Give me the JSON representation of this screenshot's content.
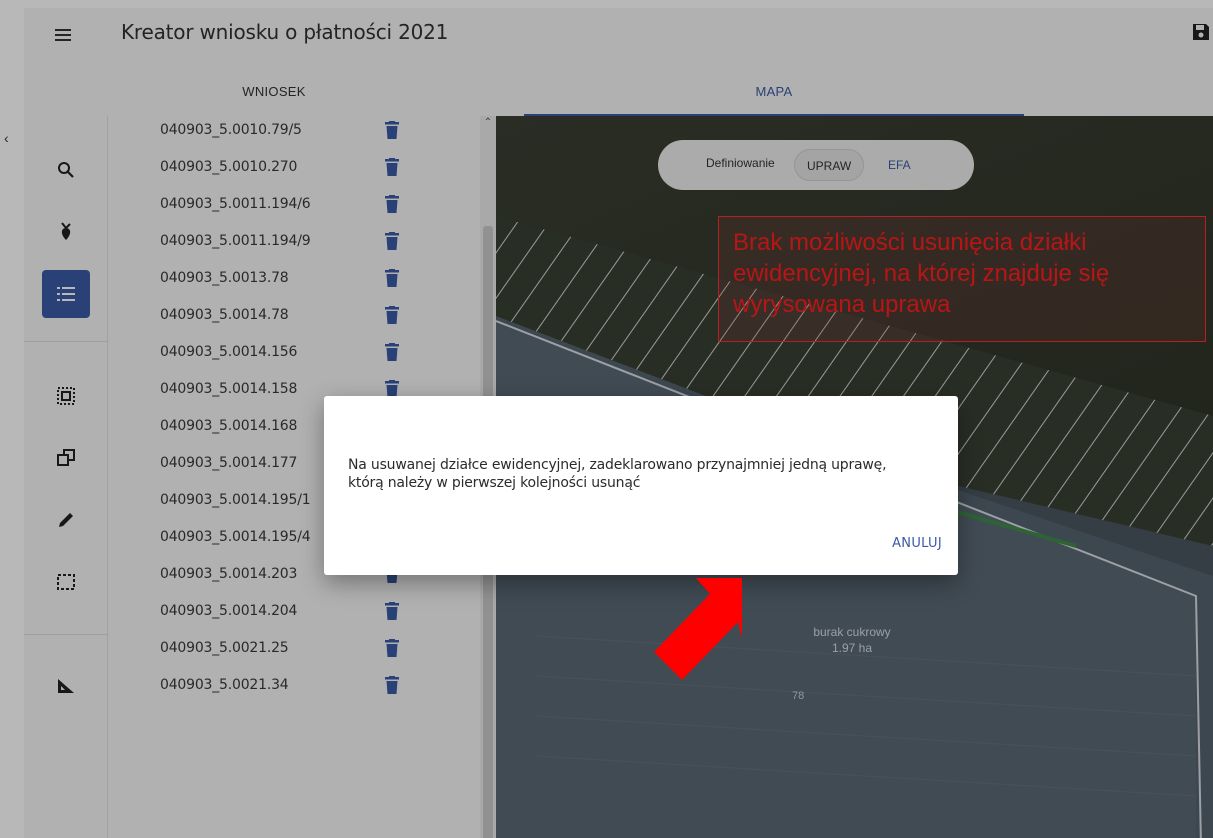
{
  "header": {
    "title": "Kreator wniosku o płatności 2021",
    "menu_icon": "menu-icon",
    "save_icon": "save-icon"
  },
  "tabs": [
    {
      "label": "WNIOSEK",
      "active": false
    },
    {
      "label": "MAPA",
      "active": true
    }
  ],
  "rail": {
    "items": [
      {
        "icon": "search-icon",
        "active": false
      },
      {
        "icon": "crop-plant-icon",
        "active": false
      },
      {
        "icon": "list-icon",
        "active": true
      },
      {
        "icon": "select-parcel-icon",
        "active": false
      },
      {
        "icon": "copy-shape-icon",
        "active": false
      },
      {
        "icon": "pencil-icon",
        "active": false
      },
      {
        "icon": "dashed-rect-icon",
        "active": false
      },
      {
        "icon": "measure-icon",
        "active": false
      }
    ]
  },
  "parcels": [
    "040903_5.0010.79/5",
    "040903_5.0010.270",
    "040903_5.0011.194/6",
    "040903_5.0011.194/9",
    "040903_5.0013.78",
    "040903_5.0014.78",
    "040903_5.0014.156",
    "040903_5.0014.158",
    "040903_5.0014.168",
    "040903_5.0014.177",
    "040903_5.0014.195/1",
    "040903_5.0014.195/4",
    "040903_5.0014.203",
    "040903_5.0014.204",
    "040903_5.0021.25",
    "040903_5.0021.34"
  ],
  "map": {
    "mode_label": "Definiowanie",
    "mode_upraw": "UPRAW",
    "mode_efa": "EFA",
    "crop_name": "burak cukrowy",
    "crop_area": "1.97 ha",
    "parcel_number": "78"
  },
  "callout": {
    "text": "Brak możliwości usunięcia działki ewidencyjnej, na której znajduje się wyrysowana uprawa"
  },
  "dialog": {
    "message": "Na usuwanej działce ewidencyjnej, zadeklarowano przynajmniej jedną uprawę, którą należy w pierwszej kolejności usunąć",
    "cancel_label": "ANULUJ"
  },
  "colors": {
    "accent": "#3a5aa6",
    "callout_red": "#ff1e1e",
    "arrow_red": "#ff0000"
  }
}
